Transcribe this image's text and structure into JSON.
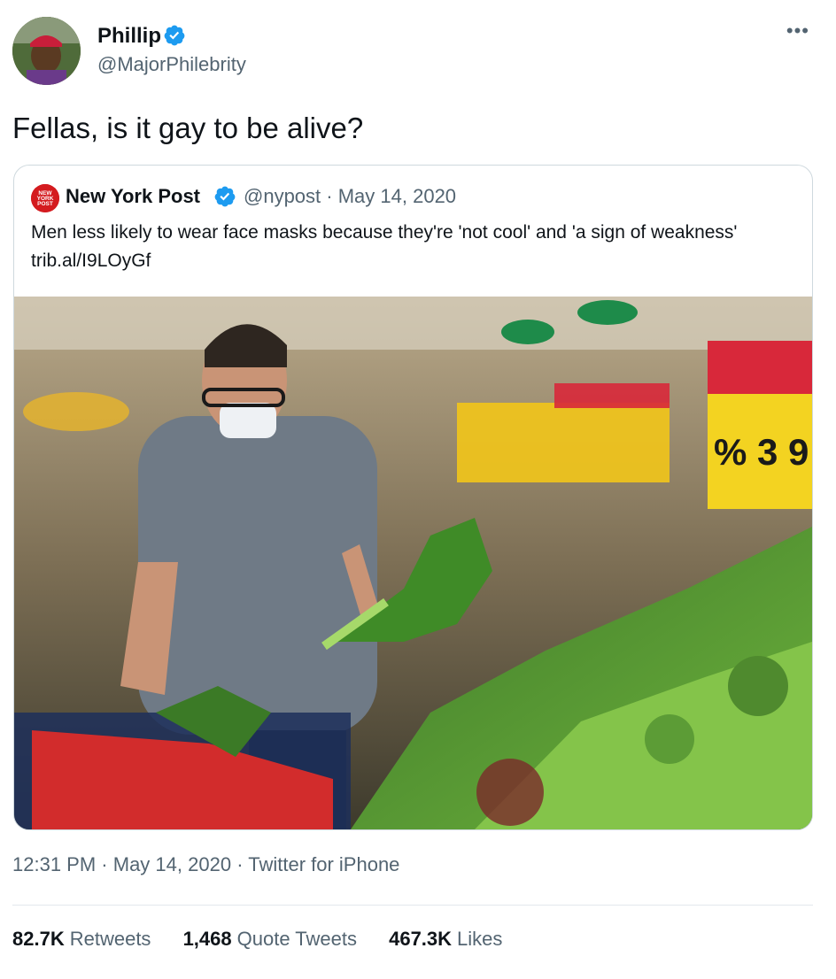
{
  "author": {
    "display_name": "Phillip",
    "handle": "@MajorPhilebrity",
    "verified_icon": "verified-badge-icon"
  },
  "more_icon": "more-horizontal-icon",
  "tweet": {
    "text": "Fellas, is it gay to be alive?"
  },
  "quoted_tweet": {
    "logo_text": "NEW YORK POST",
    "display_name": "New York Post",
    "handle": "@nypost",
    "separator": "·",
    "date": "May 14, 2020",
    "text": "Men less likely to wear face masks because they're 'not cool' and 'a sign of weakness' trib.al/I9LOyGf",
    "image_sign_1": "% 3 9"
  },
  "meta": {
    "time": "12:31 PM",
    "date": "May 14, 2020",
    "source": "Twitter for iPhone",
    "separator": "·"
  },
  "stats": {
    "retweets_count": "82.7K",
    "retweets_label": "Retweets",
    "quotes_count": "1,468",
    "quotes_label": "Quote Tweets",
    "likes_count": "467.3K",
    "likes_label": "Likes"
  },
  "colors": {
    "text": "#0f1419",
    "secondary": "#536471",
    "verified": "#1d9bf0",
    "border": "#cfd9de",
    "nypost_red": "#d41b1f"
  }
}
